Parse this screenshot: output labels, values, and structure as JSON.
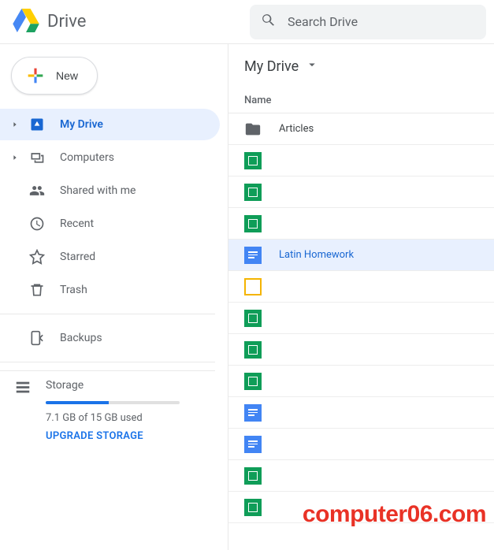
{
  "appTitle": "Drive",
  "search": {
    "placeholder": "Search Drive"
  },
  "newButton": {
    "label": "New"
  },
  "sidebar": {
    "items": [
      {
        "label": "My Drive"
      },
      {
        "label": "Computers"
      },
      {
        "label": "Shared with me"
      },
      {
        "label": "Recent"
      },
      {
        "label": "Starred"
      },
      {
        "label": "Trash"
      },
      {
        "label": "Backups"
      }
    ],
    "storage": {
      "label": "Storage",
      "usedText": "7.1 GB of 15 GB used",
      "upgrade": "UPGRADE STORAGE",
      "percent": 47
    }
  },
  "breadcrumb": "My Drive",
  "columnHeader": "Name",
  "files": [
    {
      "type": "folder",
      "name": "Articles",
      "selected": false
    },
    {
      "type": "sheet",
      "name": "",
      "selected": false
    },
    {
      "type": "sheet",
      "name": "",
      "selected": false
    },
    {
      "type": "sheet",
      "name": "",
      "selected": false
    },
    {
      "type": "doc",
      "name": "Latin Homework",
      "selected": true
    },
    {
      "type": "slide",
      "name": "",
      "selected": false
    },
    {
      "type": "sheet",
      "name": "",
      "selected": false
    },
    {
      "type": "sheet",
      "name": "",
      "selected": false
    },
    {
      "type": "sheet",
      "name": "",
      "selected": false
    },
    {
      "type": "doc",
      "name": "",
      "selected": false
    },
    {
      "type": "doc",
      "name": "",
      "selected": false
    },
    {
      "type": "sheet",
      "name": "",
      "selected": false
    },
    {
      "type": "sheet",
      "name": "",
      "selected": false
    }
  ],
  "watermark": "computer06.com"
}
